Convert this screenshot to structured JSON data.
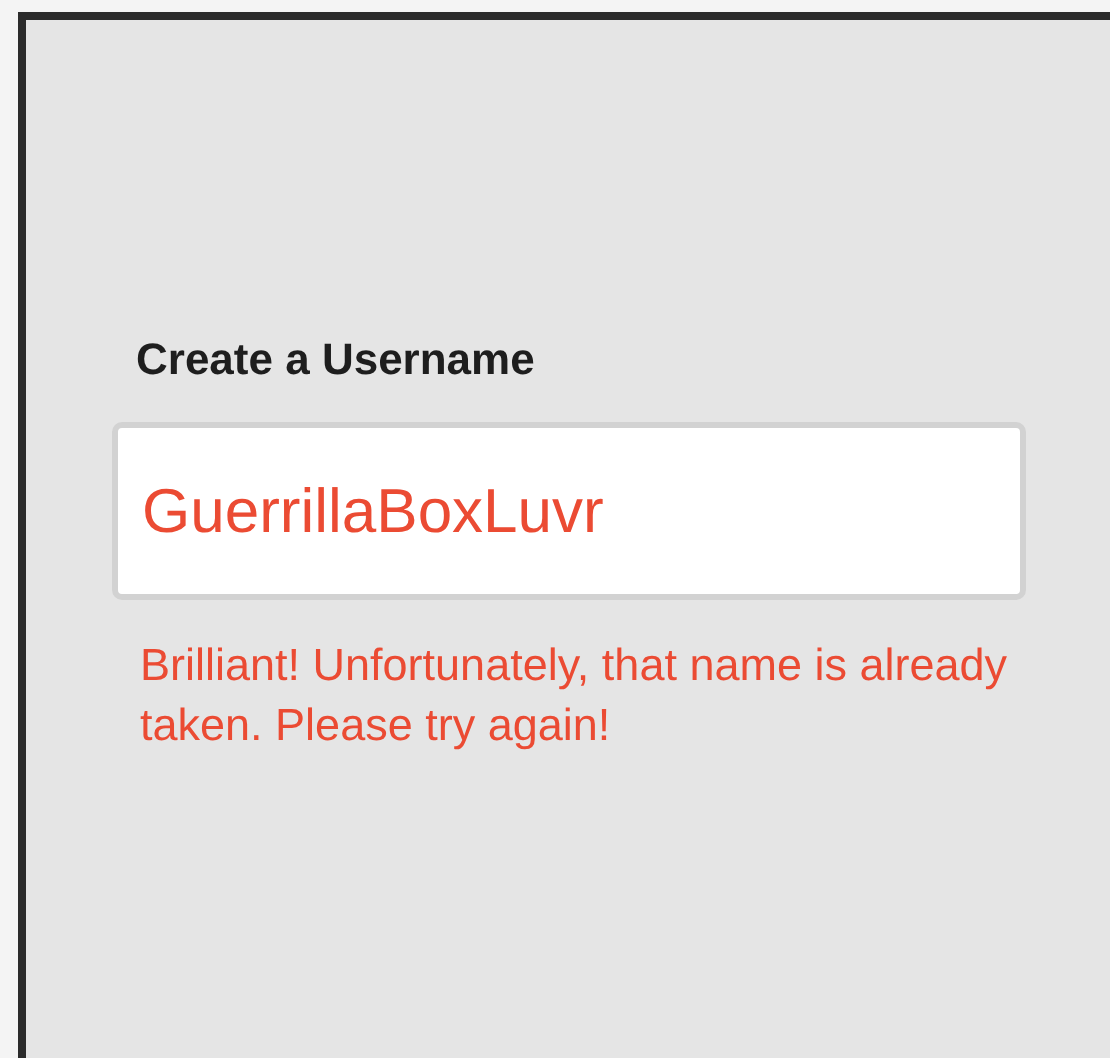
{
  "form": {
    "label": "Create a Username",
    "username_field": {
      "value": "GuerrillaBoxLuvr",
      "invalid": true
    },
    "error_message": "Brilliant! Unfortunately, that name is already taken. Please try again!"
  }
}
